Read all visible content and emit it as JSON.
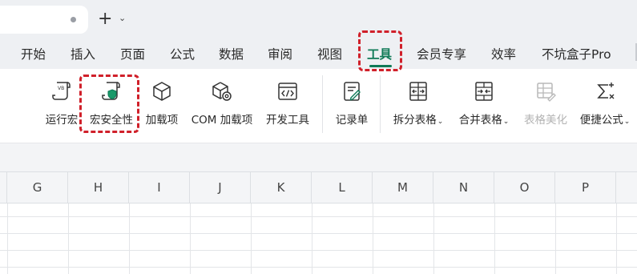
{
  "titlebar": {
    "new_tab_symbol": "+",
    "caret": "⌄"
  },
  "menu": {
    "items": [
      "开始",
      "插入",
      "页面",
      "公式",
      "数据",
      "审阅",
      "视图",
      "工具",
      "会员专享",
      "效率",
      "不坑盒子Pro"
    ],
    "active": "工具"
  },
  "ribbon": {
    "tools": [
      {
        "label": "运行宏",
        "icon": "vb-macro-icon"
      },
      {
        "label": "宏安全性",
        "icon": "macro-security-icon"
      },
      {
        "label": "加载项",
        "icon": "addin-cube-icon"
      },
      {
        "label": "COM 加载项",
        "icon": "com-addin-icon"
      },
      {
        "label": "开发工具",
        "icon": "developer-tools-icon"
      },
      {
        "label": "记录单",
        "icon": "record-form-icon"
      },
      {
        "label": "拆分表格",
        "icon": "split-table-icon",
        "dropdown": true
      },
      {
        "label": "合并表格",
        "icon": "merge-table-icon",
        "dropdown": true
      },
      {
        "label": "表格美化",
        "icon": "beautify-table-icon",
        "disabled": true
      },
      {
        "label": "便捷公式",
        "icon": "sigma-icon",
        "dropdown": true
      }
    ]
  },
  "sheet": {
    "columns": [
      "G",
      "H",
      "I",
      "J",
      "K",
      "L",
      "M",
      "N",
      "O",
      "P"
    ]
  },
  "colors": {
    "accent": "#0f7a57",
    "highlight": "#d0202a",
    "chrome": "#eef0f3"
  }
}
